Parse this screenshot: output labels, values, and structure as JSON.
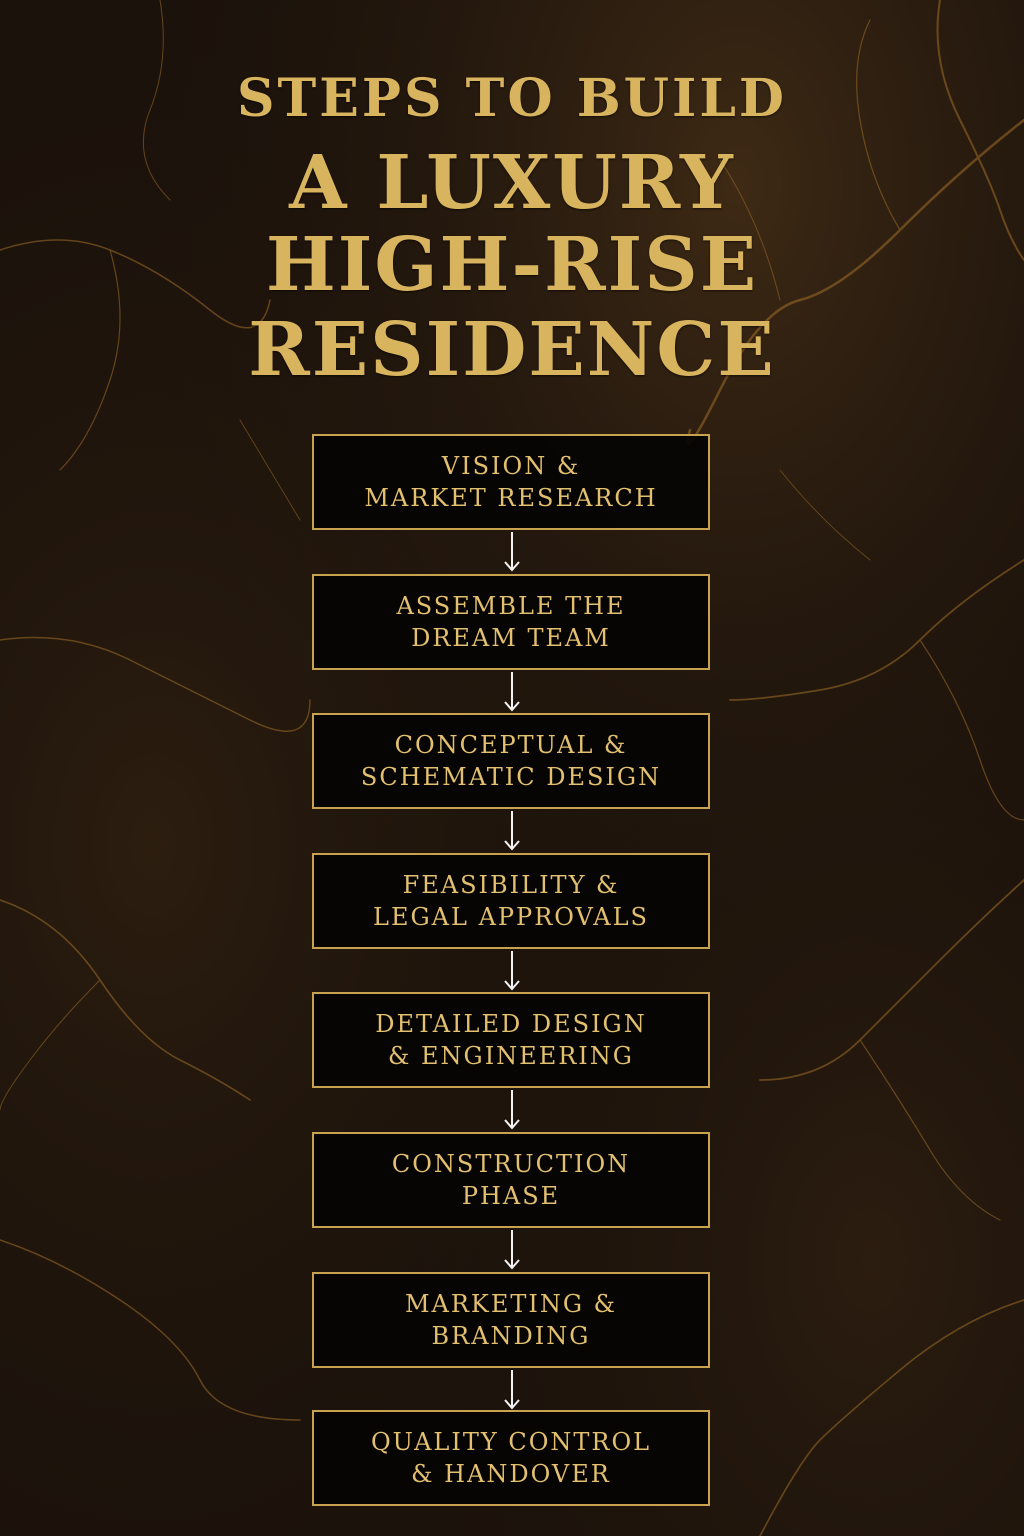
{
  "title": {
    "line1": "STEPS TO BUILD",
    "line2": "A LUXURY",
    "line3": "HIGH-RISE",
    "line4": "RESIDENCE"
  },
  "steps": [
    {
      "label": "VISION &\nMARKET RESEARCH"
    },
    {
      "label": "ASSEMBLE THE\nDREAM TEAM"
    },
    {
      "label": "CONCEPTUAL &\nSCHEMATIC DESIGN"
    },
    {
      "label": "FEASIBILITY &\nLEGAL APPROVALS"
    },
    {
      "label": "DETAILED DESIGN\n& ENGINEERING"
    },
    {
      "label": "CONSTRUCTION\nPHASE"
    },
    {
      "label": "MARKETING &\nBRANDING"
    },
    {
      "label": "QUALITY CONTROL\n& HANDOVER"
    }
  ],
  "colors": {
    "gold": "#d9b45f",
    "box_border": "#c9a24f",
    "box_fill": "#050403",
    "arrow": "#f2f2f2",
    "background": "#1c130c"
  },
  "icons": {
    "connector": "down-arrow-icon"
  }
}
